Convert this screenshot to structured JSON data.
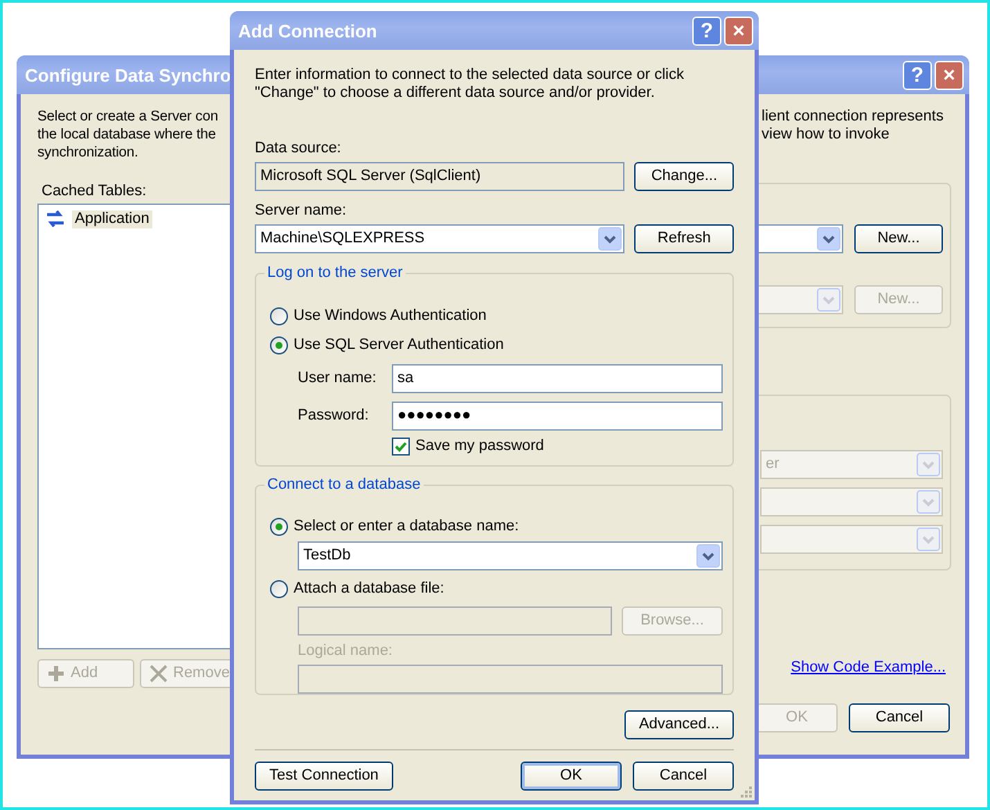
{
  "background_window": {
    "title": "Configure Data Synchro",
    "title_buttons": [
      "?",
      "×"
    ],
    "intro_left": [
      "Select or create a Server con",
      "the local database where the",
      "synchronization."
    ],
    "intro_right": [
      "lient connection represents",
      "view how to invoke"
    ],
    "cached_tables_label": "Cached Tables:",
    "cached_tables": [
      {
        "label": "Application"
      }
    ],
    "table_buttons": [
      {
        "label": "Add",
        "disabled": true
      },
      {
        "label": "Remove",
        "disabled": true
      }
    ],
    "server_rows": [
      {
        "disabled": false,
        "button": "New...",
        "button_disabled": false
      },
      {
        "disabled": true,
        "button": "New...",
        "button_disabled": true
      }
    ],
    "client_combos": [
      {
        "value": "er",
        "disabled": true
      },
      {
        "disabled": true
      },
      {
        "disabled": true
      }
    ],
    "link": "Show Code Example...",
    "buttons": [
      {
        "label": "OK",
        "disabled": true
      },
      {
        "label": "Cancel",
        "disabled": false
      }
    ]
  },
  "add_connection": {
    "title": "Add Connection",
    "title_buttons": [
      "?",
      "×"
    ],
    "intro": [
      "Enter information to connect to the selected data source or click",
      "\"Change\" to choose a different data source and/or provider."
    ],
    "data_source": {
      "label": "Data source:",
      "value": "Microsoft SQL Server (SqlClient)",
      "button": "Change..."
    },
    "server_name": {
      "label": "Server name:",
      "value": "Machine\\SQLEXPRESS",
      "button": "Refresh"
    },
    "logon_group": {
      "legend": "Log on to the server",
      "auth_options": [
        {
          "label": "Use Windows Authentication",
          "selected": false
        },
        {
          "label": "Use SQL Server Authentication",
          "selected": true
        }
      ],
      "user_name": {
        "label": "User name:",
        "value": "sa"
      },
      "password": {
        "label": "Password:",
        "value": "●●●●●●●●"
      },
      "save_password": {
        "label": "Save my password",
        "checked": true
      }
    },
    "database_group": {
      "legend": "Connect to a database",
      "options": [
        {
          "kind": "select",
          "label": "Select or enter a database name:",
          "selected": true,
          "value": "TestDb"
        },
        {
          "kind": "attach",
          "label": "Attach a database file:",
          "selected": false,
          "button": "Browse...",
          "logical_name_label": "Logical name:"
        }
      ]
    },
    "advanced_button": "Advanced...",
    "buttons": [
      {
        "label": "Test Connection",
        "default": false
      },
      {
        "label": "OK",
        "default": true
      },
      {
        "label": "Cancel",
        "default": false
      }
    ]
  }
}
